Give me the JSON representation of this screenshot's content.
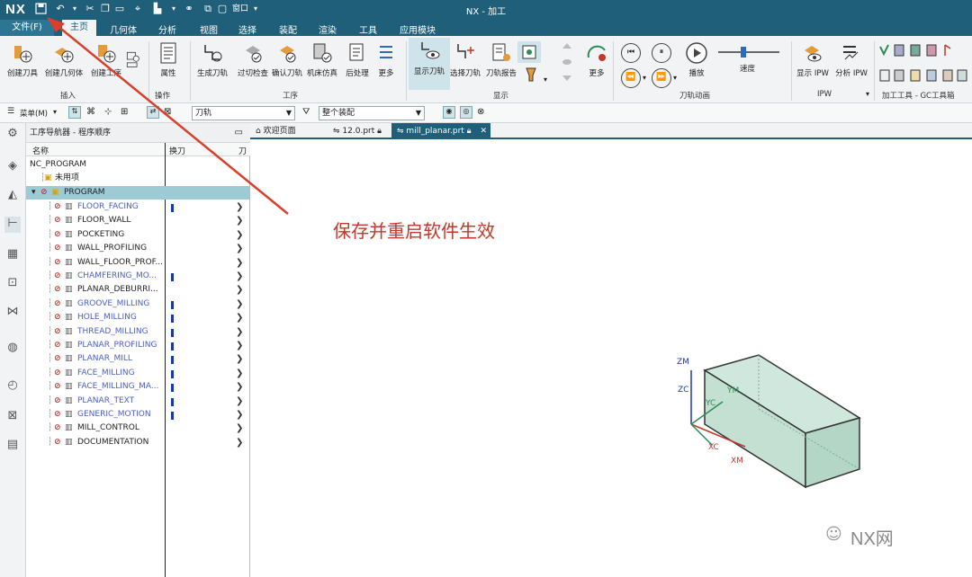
{
  "window": {
    "logo": "NX",
    "title": "NX - 加工"
  },
  "menubar": {
    "file": "文件(F)",
    "items": [
      "主页",
      "几何体",
      "分析",
      "视图",
      "选择",
      "装配",
      "渲染",
      "工具",
      "应用模块"
    ]
  },
  "ribbon": {
    "insert": {
      "buttons": [
        "创建刀具",
        "创建几何体",
        "创建工序"
      ],
      "group": "插入"
    },
    "operations": {
      "buttons": [
        "属性"
      ],
      "group": "操作"
    },
    "process": {
      "buttons": [
        "生成刀轨",
        "过切检查",
        "确认刀轨",
        "机床仿真",
        "后处理",
        "更多"
      ],
      "group": "工序"
    },
    "display": {
      "buttons": [
        "显示刀轨",
        "选择刀轨",
        "刀轨报告",
        "更多"
      ],
      "group": "显示"
    },
    "animation": {
      "buttons": [
        "播放",
        "速度"
      ],
      "group": "刀轨动画"
    },
    "ipw": {
      "buttons": [
        "显示 IPW",
        "分析 IPW"
      ],
      "group": "IPW"
    },
    "gc": {
      "group": "加工工具 - GC工具箱"
    }
  },
  "toolbar2": {
    "menu": "菜单(M)",
    "filter": "刀轨",
    "scope": "整个装配"
  },
  "navigator": {
    "title": "工序导航器 - 程序顺序",
    "col_name": "名称",
    "col_tool": "换刀",
    "col_path": "刀",
    "root": "NC_PROGRAM",
    "unused": "未用项",
    "program": "PROGRAM",
    "operations": [
      {
        "name": "FLOOR_FACING",
        "bar": true,
        "blue": true
      },
      {
        "name": "FLOOR_WALL",
        "bar": false,
        "blue": false
      },
      {
        "name": "POCKETING",
        "bar": false,
        "blue": false
      },
      {
        "name": "WALL_PROFILING",
        "bar": false,
        "blue": false
      },
      {
        "name": "WALL_FLOOR_PROF...",
        "bar": false,
        "blue": false
      },
      {
        "name": "CHAMFERING_MO...",
        "bar": true,
        "blue": true
      },
      {
        "name": "PLANAR_DEBURRI...",
        "bar": false,
        "blue": false
      },
      {
        "name": "GROOVE_MILLING",
        "bar": true,
        "blue": true
      },
      {
        "name": "HOLE_MILLING",
        "bar": true,
        "blue": true
      },
      {
        "name": "THREAD_MILLING",
        "bar": true,
        "blue": true
      },
      {
        "name": "PLANAR_PROFILING",
        "bar": true,
        "blue": true
      },
      {
        "name": "PLANAR_MILL",
        "bar": true,
        "blue": true
      },
      {
        "name": "FACE_MILLING",
        "bar": true,
        "blue": true
      },
      {
        "name": "FACE_MILLING_MA...",
        "bar": true,
        "blue": true
      },
      {
        "name": "PLANAR_TEXT",
        "bar": true,
        "blue": true
      },
      {
        "name": "GENERIC_MOTION",
        "bar": true,
        "blue": true
      },
      {
        "name": "MILL_CONTROL",
        "bar": false,
        "blue": false
      },
      {
        "name": "DOCUMENTATION",
        "bar": false,
        "blue": false
      }
    ]
  },
  "tabs": [
    "欢迎页面",
    "12.0.prt",
    "mill_planar.prt"
  ],
  "viewport": {
    "note": "保存并重启软件生效",
    "axes": {
      "zm": "ZM",
      "zc": "ZC",
      "yc": "YC",
      "ym": "YM",
      "xc": "XC",
      "xm": "XM"
    },
    "watermark": "NX网"
  },
  "colors": {
    "titlebar": "#1f5f7a",
    "annotation": "#c0392b",
    "op_blue": "#4a5fc1"
  }
}
